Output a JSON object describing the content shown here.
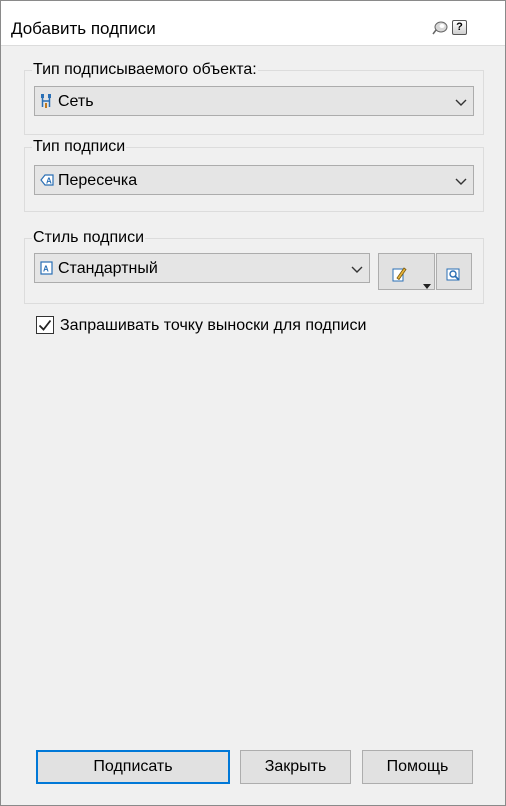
{
  "window": {
    "title": "Добавить подписи",
    "pin_icon": "pin-icon",
    "help_icon": "help-icon",
    "help_glyph": "?"
  },
  "object_type": {
    "label": "Тип подписываемого объекта:",
    "selected": "Сеть",
    "icon": "network-icon"
  },
  "label_type": {
    "label": "Тип подписи",
    "selected": "Пересечка",
    "icon": "label-type-icon"
  },
  "label_style": {
    "label": "Стиль подписи",
    "selected": "Стандартный",
    "icon": "label-style-icon",
    "edit_icon": "edit-style-icon",
    "preview_icon": "preview-icon"
  },
  "prompt_leader": {
    "label": "Запрашивать точку выноски для подписи",
    "checked": true
  },
  "buttons": {
    "label_btn": "Подписать",
    "close_btn": "Закрыть",
    "help_btn": "Помощь"
  },
  "colors": {
    "accent": "#0078d7",
    "background": "#f0f0f0",
    "button": "#e1e1e1"
  }
}
